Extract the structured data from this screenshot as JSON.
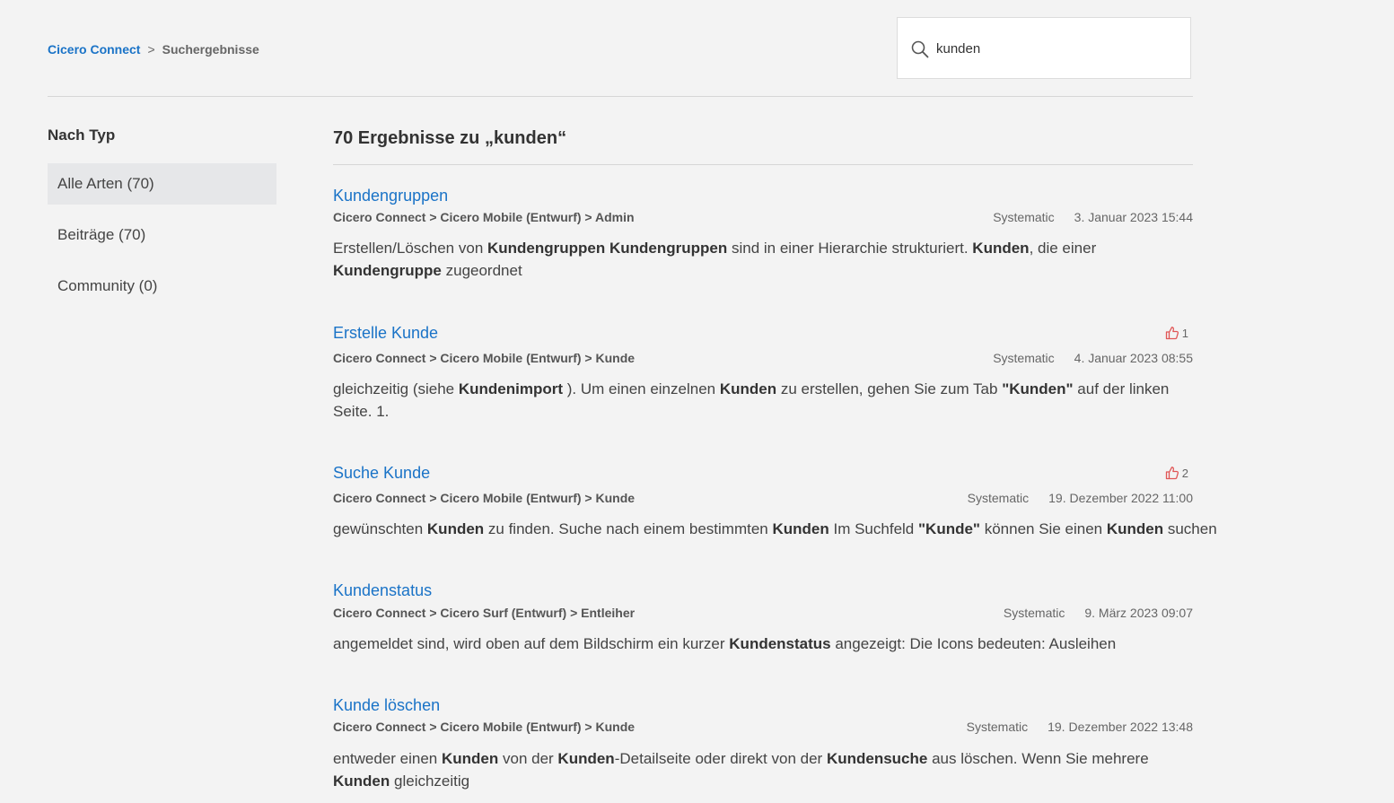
{
  "breadcrumb": {
    "home": "Cicero Connect",
    "separator": ">",
    "current": "Suchergebnisse"
  },
  "search": {
    "value": "kunden"
  },
  "sidebar": {
    "heading": "Nach Typ",
    "filters": [
      {
        "label": "Alle Arten (70)"
      },
      {
        "label": "Beiträge (70)"
      },
      {
        "label": "Community (0)"
      }
    ]
  },
  "results_title": "70 Ergebnisse zu „kunden“",
  "results": [
    {
      "title": "Kundengruppen",
      "path": "Cicero Connect > Cicero Mobile (Entwurf) > Admin",
      "author": "Systematic",
      "date": "3. Januar 2023 15:44",
      "likes": null,
      "snippet": [
        [
          "Erstellen/Löschen von ",
          false
        ],
        [
          "Kundengruppen Kundengruppen",
          true
        ],
        [
          " sind in einer Hierarchie strukturiert. ",
          false
        ],
        [
          "Kunden",
          true
        ],
        [
          ", die einer ",
          false
        ],
        [
          "Kundengruppe",
          true
        ],
        [
          " zugeordnet",
          false
        ]
      ]
    },
    {
      "title": "Erstelle Kunde",
      "path": "Cicero Connect > Cicero Mobile (Entwurf) > Kunde",
      "author": "Systematic",
      "date": "4. Januar 2023 08:55",
      "likes": "1",
      "snippet": [
        [
          "gleichzeitig (siehe ",
          false
        ],
        [
          "Kundenimport",
          true
        ],
        [
          " ). Um einen einzelnen ",
          false
        ],
        [
          "Kunden",
          true
        ],
        [
          " zu erstellen, gehen Sie zum Tab ",
          false
        ],
        [
          "\"Kunden\"",
          true
        ],
        [
          " auf der linken Seite. 1.",
          false
        ]
      ]
    },
    {
      "title": "Suche Kunde",
      "path": "Cicero Connect > Cicero Mobile (Entwurf) > Kunde",
      "author": "Systematic",
      "date": "19. Dezember 2022 11:00",
      "likes": "2",
      "snippet": [
        [
          "gewünschten ",
          false
        ],
        [
          "Kunden",
          true
        ],
        [
          " zu finden. Suche nach einem bestimmten ",
          false
        ],
        [
          "Kunden",
          true
        ],
        [
          " Im Suchfeld ",
          false
        ],
        [
          "\"Kunde\"",
          true
        ],
        [
          " können Sie einen ",
          false
        ],
        [
          "Kunden",
          true
        ],
        [
          " suchen",
          false
        ]
      ]
    },
    {
      "title": "Kundenstatus",
      "path": "Cicero Connect > Cicero Surf (Entwurf) > Entleiher",
      "author": "Systematic",
      "date": "9. März 2023 09:07",
      "likes": null,
      "snippet": [
        [
          "angemeldet sind, wird oben auf dem Bildschirm ein kurzer ",
          false
        ],
        [
          "Kundenstatus",
          true
        ],
        [
          " angezeigt: Die Icons bedeuten: Ausleihen",
          false
        ]
      ]
    },
    {
      "title": "Kunde löschen",
      "path": "Cicero Connect > Cicero Mobile (Entwurf) > Kunde",
      "author": "Systematic",
      "date": "19. Dezember 2022 13:48",
      "likes": null,
      "snippet": [
        [
          "entweder einen ",
          false
        ],
        [
          "Kunden",
          true
        ],
        [
          " von der ",
          false
        ],
        [
          "Kunden",
          true
        ],
        [
          "-Detailseite oder direkt von der ",
          false
        ],
        [
          "Kundensuche",
          true
        ],
        [
          " aus löschen. Wenn Sie mehrere ",
          false
        ],
        [
          "Kunden",
          true
        ],
        [
          " gleichzeitig",
          false
        ]
      ]
    }
  ]
}
